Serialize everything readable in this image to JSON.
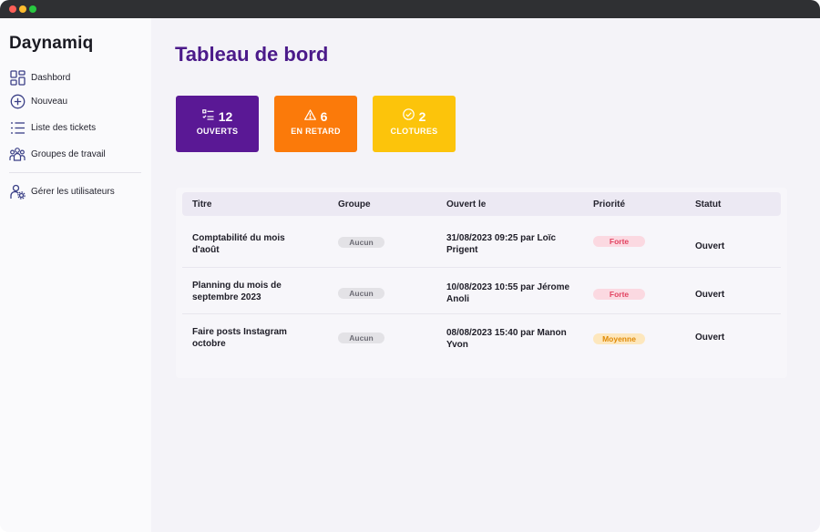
{
  "app": {
    "name": "Daynamiq"
  },
  "sidebar": {
    "items": [
      {
        "label": "Dashbord",
        "icon": "dashboard-icon"
      },
      {
        "label": "Nouveau",
        "icon": "plus-circle-icon"
      },
      {
        "label": "Liste des tickets",
        "icon": "list-icon"
      },
      {
        "label": "Groupes de travail",
        "icon": "group-icon"
      }
    ],
    "admin": {
      "label": "Gérer les utilisateurs",
      "icon": "user-settings-icon"
    }
  },
  "page": {
    "title": "Tableau de bord"
  },
  "stats": [
    {
      "count": "12",
      "label": "OUVERTS",
      "icon": "checklist-icon",
      "color": "#5a1895"
    },
    {
      "count": "6",
      "label": "EN RETARD",
      "icon": "warning-icon",
      "color": "#fb7a0a"
    },
    {
      "count": "2",
      "label": "CLOTURES",
      "icon": "check-circle-icon",
      "color": "#fcc40b"
    }
  ],
  "table": {
    "headers": {
      "title": "Titre",
      "group": "Groupe",
      "opened": "Ouvert le",
      "priority": "Priorité",
      "status": "Statut"
    },
    "rows": [
      {
        "title": "Comptabilité du mois d'août",
        "group": "Aucun",
        "opened": "31/08/2023 09:25 par Loïc Prigent",
        "priority": "Forte",
        "priority_color": "#e24462",
        "status": "Ouvert"
      },
      {
        "title": "Planning du mois de septembre 2023",
        "group": "Aucun",
        "opened": "10/08/2023 10:55 par Jérome Anoli",
        "priority": "Forte",
        "priority_color": "#e24462",
        "status": "Ouvert"
      },
      {
        "title": "Faire posts Instagram octobre",
        "group": "Aucun",
        "opened": "08/08/2023 15:40 par Manon Yvon",
        "priority": "Moyenne",
        "priority_color": "#e08a06",
        "status": "Ouvert"
      }
    ]
  }
}
